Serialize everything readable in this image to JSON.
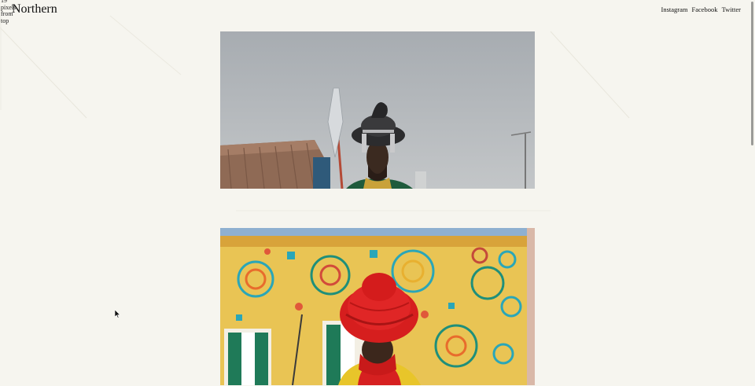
{
  "debug": {
    "note": "19 pixels from top"
  },
  "site": {
    "title": "Northern"
  },
  "nav": {
    "instagram": "Instagram",
    "facebook": "Facebook",
    "twitter": "Twitter"
  },
  "colors": {
    "background": "#f6f5ef",
    "text": "#111111"
  }
}
